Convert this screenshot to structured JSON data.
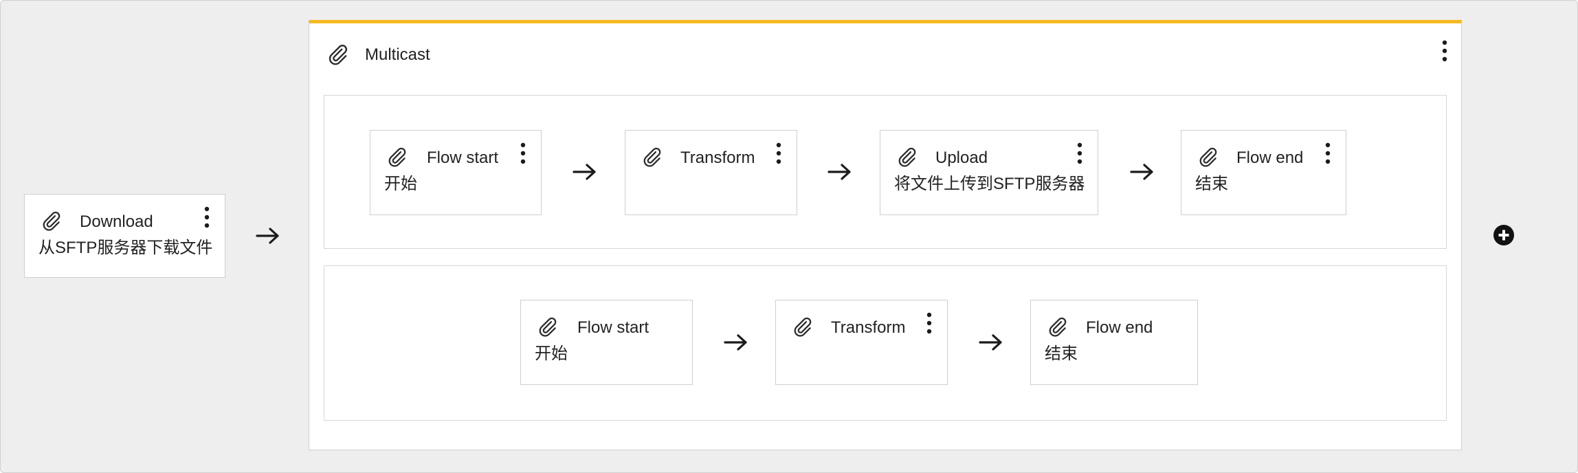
{
  "download": {
    "title": "Download",
    "subtitle": "从SFTP服务器下载文件",
    "icon": "paperclip-icon"
  },
  "multicast": {
    "title": "Multicast",
    "accent_color": "#f5b921"
  },
  "branch1": {
    "flow_start": {
      "title": "Flow start",
      "subtitle": "开始"
    },
    "transform": {
      "title": "Transform"
    },
    "upload": {
      "title": "Upload",
      "subtitle": "将文件上传到SFTP服务器"
    },
    "flow_end": {
      "title": "Flow end",
      "subtitle": "结束"
    }
  },
  "branch2": {
    "flow_start": {
      "title": "Flow start",
      "subtitle": "开始"
    },
    "transform": {
      "title": "Transform"
    },
    "flow_end": {
      "title": "Flow end",
      "subtitle": "结束"
    }
  },
  "icons": {
    "node": "paperclip-icon",
    "menu": "kebab-menu-icon",
    "connector": "arrow-right-icon",
    "add": "plus-circle-icon"
  }
}
